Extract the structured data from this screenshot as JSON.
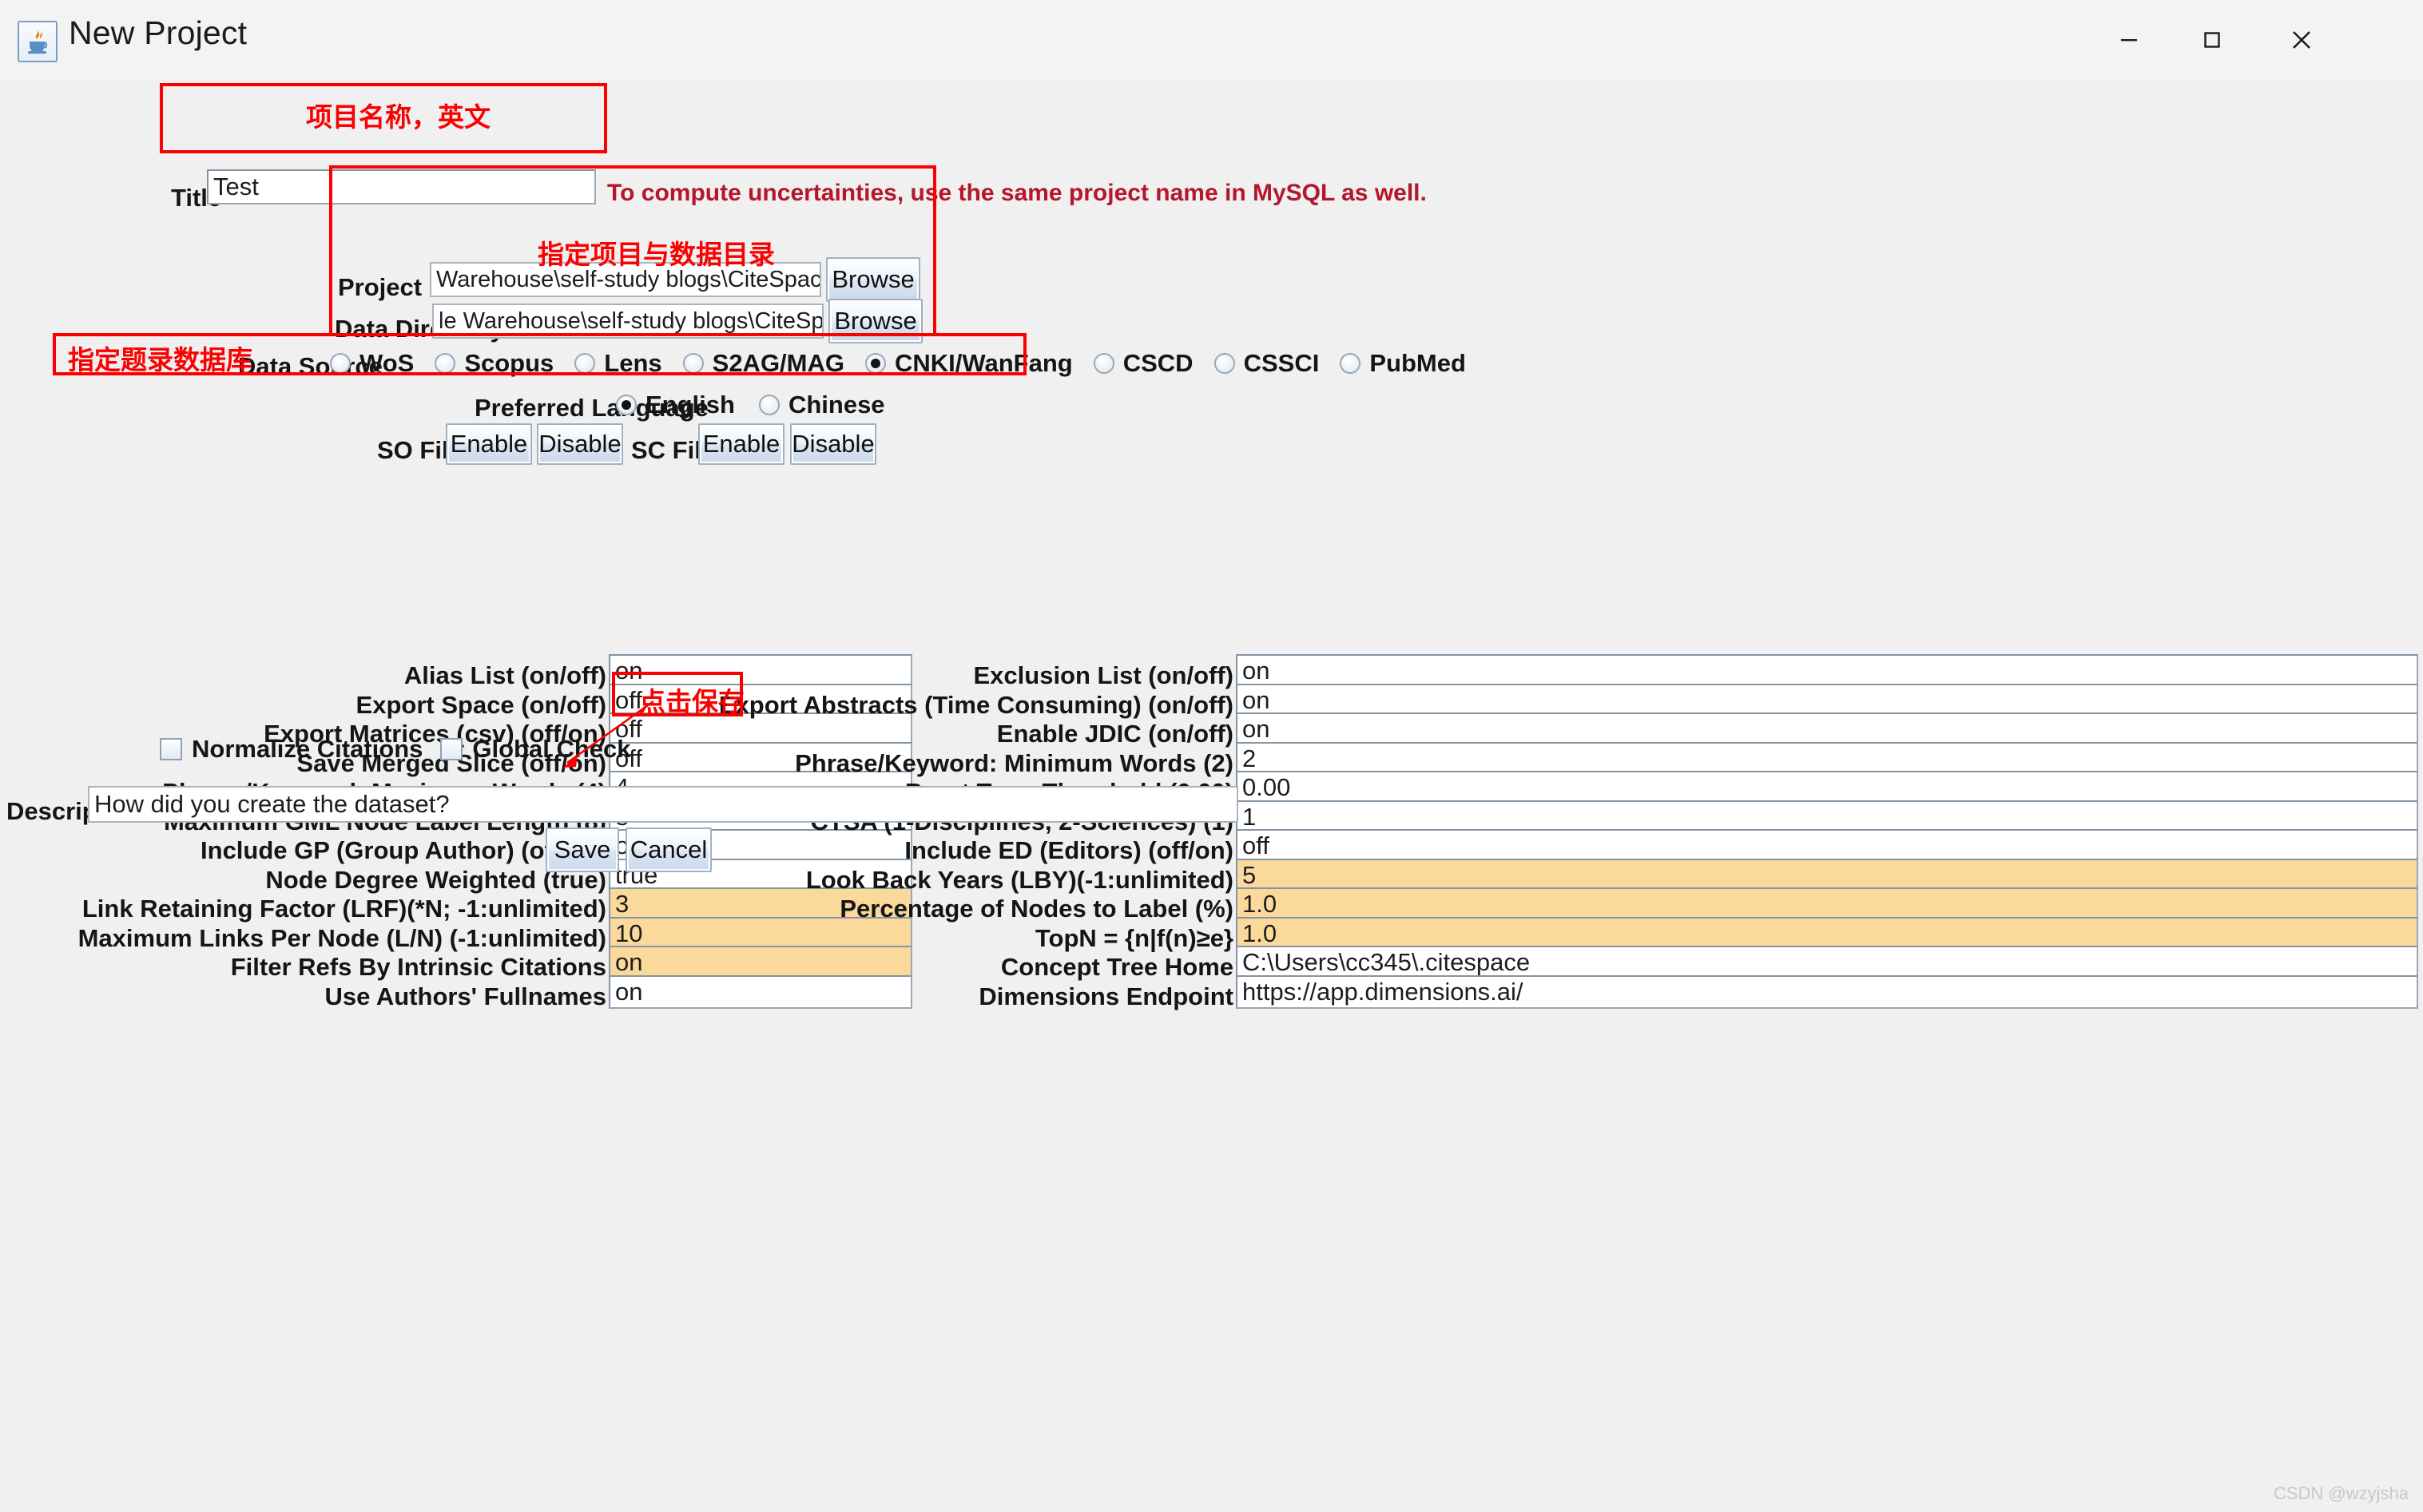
{
  "window": {
    "title": "New Project",
    "icon": "java-coffee-cup-icon",
    "controls": {
      "minimize": "—",
      "maximize": "☐",
      "close": "✕"
    }
  },
  "watermark": "CSDN @wzyjsha",
  "title_row": {
    "label": "Title",
    "value": "Test",
    "hint": "To compute uncertainties, use the same project name in MySQL as well.",
    "annotation": "项目名称，英文"
  },
  "paths": {
    "project_home": {
      "label": "Project Home",
      "value": "Warehouse\\self-study blogs\\CiteSpace\\file_structure\\project",
      "browse_label": "Browse"
    },
    "data_directory": {
      "label": "Data Directory",
      "value": "le Warehouse\\self-study blogs\\CiteSpace\\file_structure\\data",
      "browse_label": "Browse"
    },
    "annotation": "指定项目与数据目录"
  },
  "data_source": {
    "label": "Data Source",
    "annotation": "指定题录数据库",
    "selected": "CNKI/WanFang",
    "options": [
      "WoS",
      "Scopus",
      "Lens",
      "S2AG/MAG",
      "CNKI/WanFang",
      "CSCD",
      "CSSCI",
      "PubMed"
    ]
  },
  "preferred_language": {
    "label": "Preferred Language",
    "selected": "English",
    "options": [
      "English",
      "Chinese"
    ]
  },
  "filters": {
    "so": {
      "label": "SO Filter:",
      "enable": "Enable",
      "disable": "Disable"
    },
    "sc": {
      "label": "SC Filter:",
      "enable": "Enable",
      "disable": "Disable"
    }
  },
  "left_options": [
    {
      "label": "Alias List (on/off)",
      "value": "on",
      "highlighted": false
    },
    {
      "label": "Export Space (on/off)",
      "value": "off",
      "highlighted": false
    },
    {
      "label": "Export Matrices (csv) (off/on)",
      "value": "off",
      "highlighted": false
    },
    {
      "label": "Save Merged Slice (off/on)",
      "value": "off",
      "highlighted": false
    },
    {
      "label": "Phrase/Keyword: Maximum Words (4)",
      "value": "4",
      "highlighted": false
    },
    {
      "label": "Maximum GML Node Label Length (8)",
      "value": "8",
      "highlighted": false
    },
    {
      "label": "Include GP (Group Author) (off/on)",
      "value": "off",
      "highlighted": false
    },
    {
      "label": "Node Degree Weighted (true)",
      "value": "true",
      "highlighted": false
    },
    {
      "label": "Link Retaining Factor (LRF)(*N; -1:unlimited)",
      "value": "3",
      "highlighted": true
    },
    {
      "label": "Maximum Links Per Node (L/N) (-1:unlimited)",
      "value": "10",
      "highlighted": true
    },
    {
      "label": "Filter Refs By Intrinsic Citations",
      "value": "on",
      "highlighted": true
    },
    {
      "label": "Use Authors' Fullnames",
      "value": "on",
      "highlighted": false
    }
  ],
  "right_options": [
    {
      "label": "Exclusion List (on/off)",
      "value": "on",
      "highlighted": false
    },
    {
      "label": "Export Abstracts (Time Consuming) (on/off)",
      "value": "on",
      "highlighted": false
    },
    {
      "label": "Enable JDIC (on/off)",
      "value": "on",
      "highlighted": false
    },
    {
      "label": "Phrase/Keyword: Minimum Words (2)",
      "value": "2",
      "highlighted": false
    },
    {
      "label": "Burst Term Threshold (0.00)",
      "value": "0.00",
      "highlighted": false
    },
    {
      "label": "CTSA (1-Disciplines, 2-Sciences) (1)",
      "value": "1",
      "highlighted": false
    },
    {
      "label": "Include ED (Editors) (off/on)",
      "value": "off",
      "highlighted": false
    },
    {
      "label": "Look Back Years (LBY)(-1:unlimited)",
      "value": "5",
      "highlighted": true
    },
    {
      "label": "Percentage of Nodes to Label (%)",
      "value": "1.0",
      "highlighted": true
    },
    {
      "label": "TopN = {n|f(n)≥e}",
      "value": "1.0",
      "highlighted": true
    },
    {
      "label": "Concept Tree Home",
      "value": "C:\\Users\\cc345\\.citespace",
      "highlighted": false
    },
    {
      "label": "Dimensions Endpoint",
      "value": "https://app.dimensions.ai/",
      "highlighted": false
    }
  ],
  "checkboxes": [
    {
      "label": "Normalize Citations",
      "checked": false
    },
    {
      "label": "Global Check",
      "checked": false
    }
  ],
  "description": {
    "label": "Description",
    "value": "How did you create the dataset?"
  },
  "actions": {
    "save": "Save",
    "cancel": "Cancel",
    "annotation": "点击保存"
  },
  "colors": {
    "annotation_red": "#fb0000",
    "hint_red": "#b4162a",
    "highlight_field": "#fbd99a"
  }
}
